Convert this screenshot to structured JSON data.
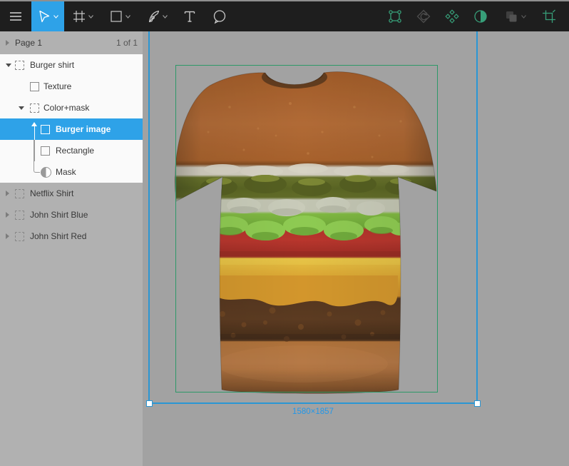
{
  "toolbar": {
    "tools": [
      {
        "name": "menu",
        "icon": "hamburger-icon"
      },
      {
        "name": "move-tool",
        "icon": "cursor-icon",
        "active": true,
        "has_dropdown": true
      },
      {
        "name": "frame-tool",
        "icon": "frame-icon",
        "has_dropdown": true
      },
      {
        "name": "shape-tool",
        "icon": "rectangle-icon",
        "has_dropdown": true
      },
      {
        "name": "pen-tool",
        "icon": "pen-icon",
        "has_dropdown": true
      },
      {
        "name": "text-tool",
        "icon": "text-icon"
      },
      {
        "name": "comment-tool",
        "icon": "speech-bubble-icon"
      }
    ],
    "right_tools": [
      {
        "name": "edit-object",
        "icon": "edit-object-icon",
        "enabled": true
      },
      {
        "name": "reset-instance",
        "icon": "reset-instance-icon",
        "enabled": false
      },
      {
        "name": "create-component",
        "icon": "component-icon",
        "enabled": true
      },
      {
        "name": "use-as-mask",
        "icon": "mask-icon",
        "enabled": true
      },
      {
        "name": "boolean-groups",
        "icon": "boolean-icon",
        "enabled": false,
        "has_dropdown": true
      },
      {
        "name": "crop-image",
        "icon": "crop-icon",
        "enabled": true
      }
    ]
  },
  "sidebar": {
    "page_header": {
      "title": "Page 1",
      "count": "1 of 1"
    },
    "layers": [
      {
        "name": "Burger shirt",
        "type": "frame",
        "depth": 0,
        "expanded": true
      },
      {
        "name": "Texture",
        "type": "rectangle",
        "depth": 1
      },
      {
        "name": "Color+mask",
        "type": "frame",
        "depth": 1,
        "expanded": true
      },
      {
        "name": "Burger image",
        "type": "rectangle",
        "depth": 2,
        "selected": true,
        "masked": true
      },
      {
        "name": "Rectangle",
        "type": "rectangle",
        "depth": 2,
        "masked": true
      },
      {
        "name": "Mask",
        "type": "mask",
        "depth": 2
      },
      {
        "name": "Netflix Shirt",
        "type": "frame",
        "depth": 0,
        "expanded": false
      },
      {
        "name": "John Shirt Blue",
        "type": "frame",
        "depth": 0,
        "expanded": false
      },
      {
        "name": "John Shirt Red",
        "type": "frame",
        "depth": 0,
        "expanded": false
      }
    ]
  },
  "canvas": {
    "selection_label": "1580×1857",
    "selected_object": "Burger image"
  },
  "colors": {
    "accent_blue": "#2ea2e8",
    "selection_blue": "#2a96d4",
    "layer_selection_green": "#2d9868",
    "toolbar_green": "#379e78",
    "toolbar_bg": "#1e1e1e",
    "canvas_bg": "#a2a2a2",
    "sidebar_bg": "#b1b1b1",
    "panel_white": "#fafafa"
  }
}
